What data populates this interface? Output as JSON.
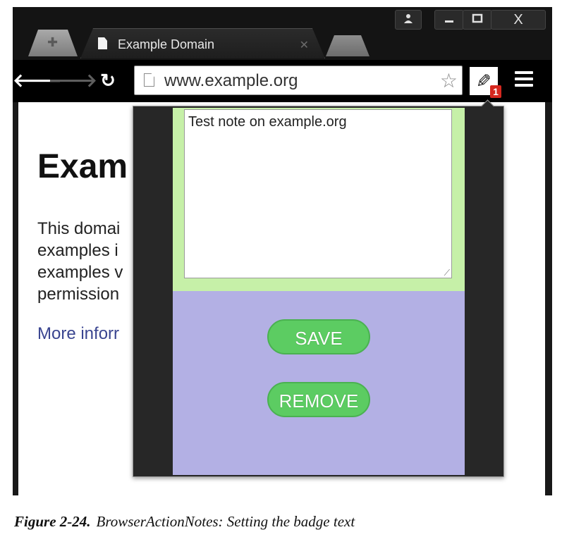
{
  "browser": {
    "tabs": [
      {
        "label": "Example Domain",
        "icon": "document-icon",
        "active": true
      }
    ],
    "inactive_tab_icon": "puzzle-icon",
    "window_controls": {
      "profile": "person-icon",
      "minimize": "minimize-icon",
      "maximize": "maximize-icon",
      "close": "X"
    },
    "toolbar": {
      "back_icon": "back-arrow-icon",
      "forward_icon": "forward-arrow-icon",
      "reload_icon": "reload-icon",
      "url": "www.example.org",
      "star_icon": "star-icon",
      "extension_icon": "pencil-icon",
      "extension_badge": "1",
      "menu_icon": "hamburger-menu-icon"
    }
  },
  "page": {
    "heading": "Exam",
    "paragraph_lines": [
      "This domai",
      "examples i",
      "examples v",
      "permission"
    ],
    "link": "More inforr"
  },
  "popup": {
    "note_text": "Test note on example.org",
    "save_label": "SAVE",
    "remove_label": "REMOVE",
    "colors": {
      "note_panel": "#c6f0a8",
      "action_panel": "#b3b0e4",
      "button": "#5ccc62",
      "side_bars": "#272727"
    }
  },
  "caption": {
    "label": "Figure 2-24.",
    "text": "BrowserActionNotes: Setting the badge text"
  },
  "colors": {
    "badge": "#d6281f",
    "link": "#3a4590",
    "browser_frame": "#141414"
  }
}
